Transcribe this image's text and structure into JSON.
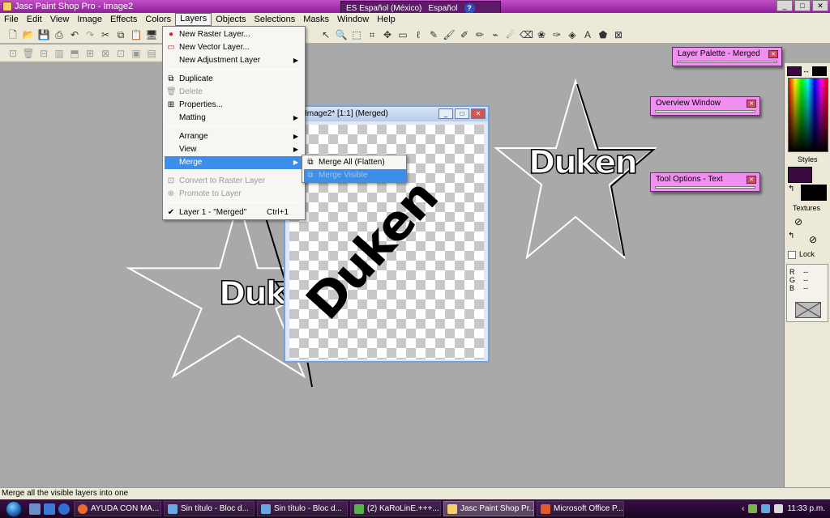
{
  "window": {
    "title": "Jasc Paint Shop Pro - Image2",
    "controls": [
      "_",
      "□",
      "✕"
    ]
  },
  "language_bar": {
    "lang": "ES Español (México)",
    "keyboard": "Español",
    "help": "?"
  },
  "menubar": [
    "File",
    "Edit",
    "View",
    "Image",
    "Effects",
    "Colors",
    "Layers",
    "Objects",
    "Selections",
    "Masks",
    "Window",
    "Help"
  ],
  "layers_menu": {
    "new_raster": "New Raster Layer...",
    "new_vector": "New Vector Layer...",
    "new_adjustment": "New Adjustment Layer",
    "duplicate": "Duplicate",
    "delete": "Delete",
    "properties": "Properties...",
    "matting": "Matting",
    "arrange": "Arrange",
    "view": "View",
    "merge": "Merge",
    "convert": "Convert to Raster Layer",
    "promote": "Promote to Layer",
    "layer_checked": "Layer 1 - \"Merged\"",
    "layer_shortcut": "Ctrl+1"
  },
  "merge_submenu": {
    "merge_all": "Merge All (Flatten)",
    "merge_visible": "Merge Visible"
  },
  "image_window": {
    "title": "Image2* [1:1] (Merged)",
    "big_text": "Duken"
  },
  "canvas_text": {
    "left_star": "Duken",
    "right_star": "Duken"
  },
  "palettes": {
    "layer_palette": "Layer Palette - Merged",
    "overview": "Overview Window",
    "tool_options": "Tool Options - Text"
  },
  "right_panel": {
    "styles": "Styles",
    "textures": "Textures",
    "lock": "Lock",
    "r": "R",
    "g": "G",
    "b": "B",
    "r_val": "--",
    "g_val": "--",
    "b_val": "--"
  },
  "status": "Merge all the visible layers into one",
  "taskbar": {
    "tasks": [
      "AYUDA CON MA...",
      "Sin título - Bloc d...",
      "Sin título - Bloc d...",
      "(2) KaRoLinE.+++...",
      "Jasc Paint Shop Pr...",
      "Microsoft Office P..."
    ],
    "active_index": 4,
    "clock": "11:33 p.m."
  },
  "colors": {
    "titlebar": "#8e1f96",
    "palette": "#f190f0",
    "highlight": "#3d8ee8",
    "taskbar": "#2a0a35"
  }
}
